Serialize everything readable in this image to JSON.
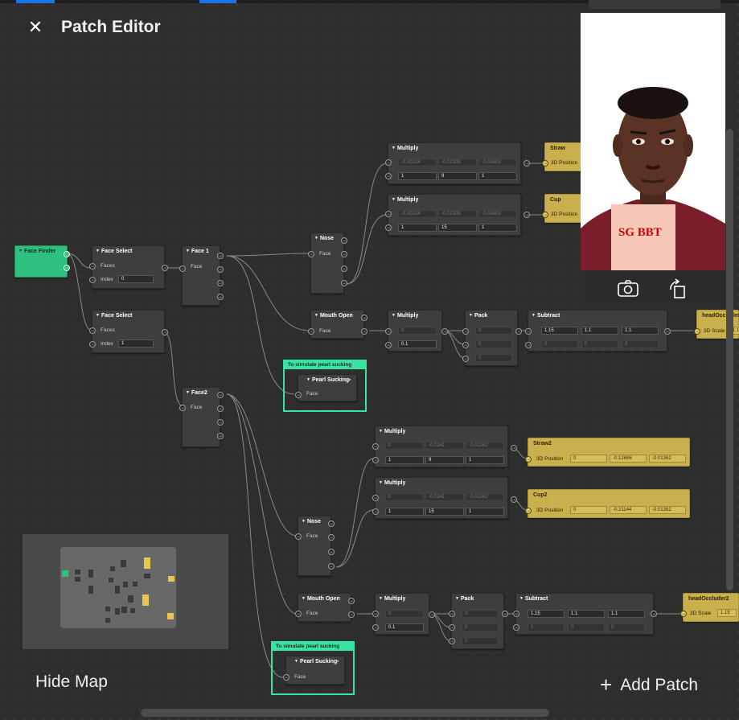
{
  "header": {
    "title": "Patch Editor",
    "close_icon": "close-icon"
  },
  "footer": {
    "hide_map": "Hide Map",
    "add_patch": "Add Patch",
    "add_icon": "plus-icon"
  },
  "preview": {
    "sign_text": "SG BBT",
    "flip_camera_icon": "flip-camera-icon",
    "rotate_icon": "rotate-icon"
  },
  "nodes": {
    "face_finder": {
      "title": "Face Finder"
    },
    "face_select_1": {
      "title": "Face Select",
      "faces": "Faces",
      "index": "Index",
      "index_value": "0"
    },
    "face_select_2": {
      "title": "Face Select",
      "faces": "Faces",
      "index": "Index",
      "index_value": "1"
    },
    "face1": {
      "title": "Face 1",
      "face": "Face"
    },
    "face2": {
      "title": "Face2",
      "face": "Face"
    },
    "nose1": {
      "title": "Nose",
      "face": "Face"
    },
    "nose2": {
      "title": "Nose",
      "face": "Face"
    },
    "mouth_open1": {
      "title": "Mouth Open",
      "face": "Face"
    },
    "mouth_open2": {
      "title": "Mouth Open",
      "face": "Face"
    },
    "multiply_a": {
      "title": "Multiply",
      "row1": [
        "-0.00104",
        "-0.01308",
        "-0.01403"
      ],
      "row2": [
        "1",
        "9",
        "1"
      ]
    },
    "multiply_b": {
      "title": "Multiply",
      "row1": [
        "-0.00104",
        "-0.01308",
        "-0.01403"
      ],
      "row2": [
        "1",
        "15",
        "1"
      ]
    },
    "multiply_c": {
      "title": "Multiply",
      "row1": [
        "0"
      ],
      "row2": [
        "0.1"
      ]
    },
    "multiply_d": {
      "title": "Multiply",
      "row1": [
        "0",
        "-0.0141",
        "-0.01362"
      ],
      "row2": [
        "1",
        "9",
        "1"
      ]
    },
    "multiply_e": {
      "title": "Multiply",
      "row1": [
        "0",
        "-0.0141",
        "-0.01362"
      ],
      "row2": [
        "1",
        "15",
        "1"
      ]
    },
    "multiply_f": {
      "title": "Multiply",
      "row1": [
        "0"
      ],
      "row2": [
        "0.1"
      ]
    },
    "pack1": {
      "title": "Pack",
      "values": [
        "0",
        "0",
        "0"
      ]
    },
    "pack2": {
      "title": "Pack",
      "values": [
        "0",
        "0",
        "0"
      ]
    },
    "subtract1": {
      "title": "Subtract",
      "row1": [
        "1.15",
        "1.1",
        "1.1"
      ],
      "row2": [
        "0",
        "0",
        "0"
      ]
    },
    "subtract2": {
      "title": "Subtract",
      "row1": [
        "1.15",
        "1.1",
        "1.1"
      ],
      "row2": [
        "0",
        "0",
        "0"
      ]
    },
    "straw": {
      "title": "Straw",
      "port": "3D Position"
    },
    "cup": {
      "title": "Cup",
      "port": "3D Position"
    },
    "head_occluder": {
      "title": "headOccluder",
      "port": "3D Scale",
      "value": "1.1"
    },
    "straw2": {
      "title": "Straw2",
      "port": "3D Position",
      "values": [
        "0",
        "-0.12686",
        "-0.01362"
      ]
    },
    "cup2": {
      "title": "Cup2",
      "port": "3D Position",
      "values": [
        "0",
        "-0.21144",
        "-0.01362"
      ]
    },
    "head_occluder2": {
      "title": "headOccluder2",
      "port": "3D Scale",
      "value": "1.15"
    },
    "pearl1": {
      "comment": "To simulate pearl sucking",
      "title": "Pearl Sucking",
      "face": "Face"
    },
    "pearl2": {
      "comment": "To simulate pearl sucking",
      "title": "Pearl Sucking",
      "face": "Face"
    }
  },
  "colors": {
    "patch_yellow": "#c9b04c",
    "face_finder_green": "#2fbf7e",
    "comment_green": "#37e4a1",
    "node_gray": "#3e3e3e",
    "canvas": "#2e2e2e"
  }
}
